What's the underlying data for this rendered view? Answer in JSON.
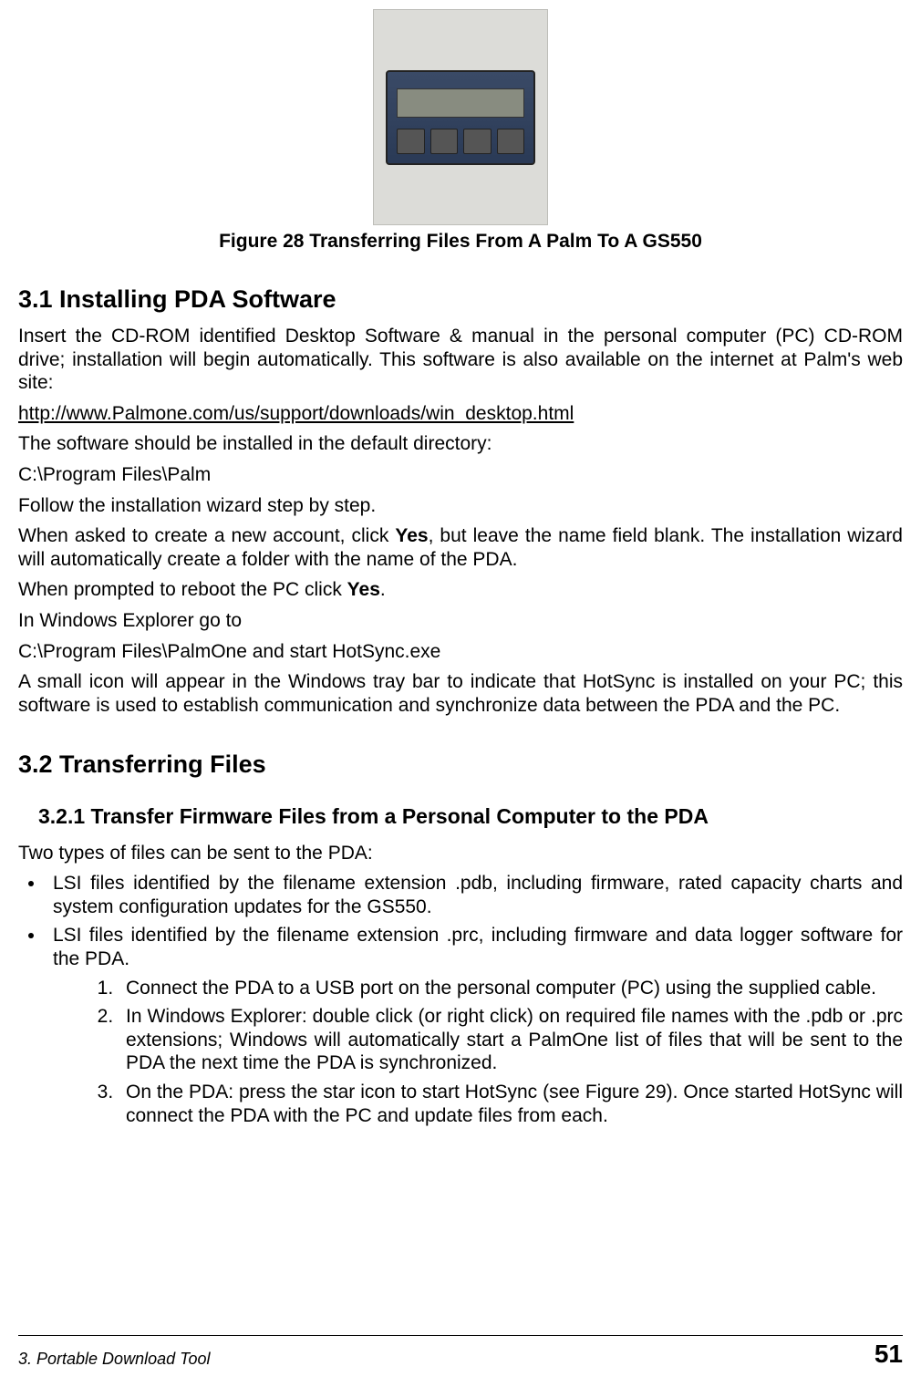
{
  "figure": {
    "caption": "Figure 28  Transferring Files From A Palm To A GS550"
  },
  "section31": {
    "heading": "3.1 Installing PDA Software",
    "p1": "Insert the CD-ROM identified Desktop Software & manual in the personal computer (PC) CD-ROM drive; installation will begin automatically. This software is also available on the internet at Palm's web site:",
    "url": "http://www.Palmone.com/us/support/downloads/win_desktop.html",
    "p2": "The software should be installed in the default directory:",
    "dir1": "C:\\Program Files\\Palm",
    "p3": "Follow the installation wizard step by step.",
    "p4a": "When asked to create a new account, click ",
    "p4yes": "Yes",
    "p4b": ", but leave the name field blank. The installation wizard will automatically create a folder with the name of the PDA.",
    "p5a": "When prompted to reboot the PC click ",
    "p5yes": "Yes",
    "p5b": ".",
    "p6": "In Windows Explorer go to",
    "dir2": "C:\\Program Files\\PalmOne and start HotSync.exe",
    "p7": "A small icon will appear in the Windows tray bar to indicate that HotSync is installed on your PC; this software is used to establish communication and synchronize data between the PDA and the PC."
  },
  "section32": {
    "heading": "3.2 Transferring Files",
    "sub321": {
      "heading": "3.2.1 Transfer Firmware Files from a Personal Computer to the PDA",
      "intro": "Two types of files can be sent to the PDA:",
      "bullets": [
        "LSI files identified by the filename extension .pdb, including firmware, rated capacity charts and system configuration updates for the GS550.",
        "LSI files identified by the filename extension .prc, including firmware and data logger software for the PDA."
      ],
      "steps": [
        "Connect the PDA to a USB port on the personal computer (PC) using the supplied cable.",
        "In Windows Explorer: double click (or right click) on required file names with the .pdb or .prc extensions; Windows will automatically start a PalmOne list of files that will be sent to the PDA the next time the PDA is synchronized.",
        "On the PDA: press the star icon to start HotSync (see Figure 29). Once started HotSync will connect the PDA with the PC and update files from each."
      ]
    }
  },
  "footer": {
    "left": "3. Portable Download Tool",
    "right": "51"
  }
}
